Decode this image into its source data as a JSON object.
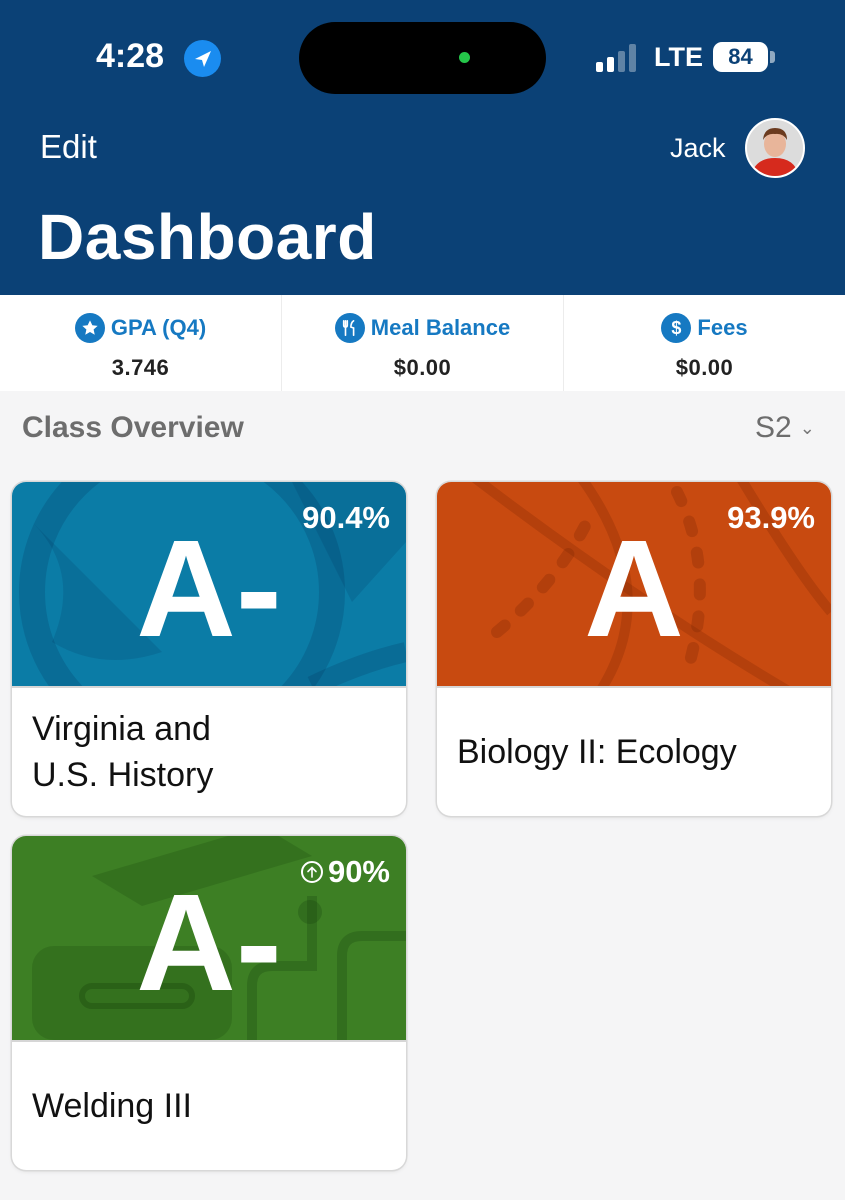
{
  "status_bar": {
    "time": "4:28",
    "network": "LTE",
    "battery": "84"
  },
  "header": {
    "edit_label": "Edit",
    "user_name": "Jack",
    "title": "Dashboard"
  },
  "stats": [
    {
      "label": "GPA (Q4)",
      "value": "3.746",
      "icon": "star-icon"
    },
    {
      "label": "Meal Balance",
      "value": "$0.00",
      "icon": "utensils-icon"
    },
    {
      "label": "Fees",
      "value": "$0.00",
      "icon": "dollar-icon"
    }
  ],
  "class_overview": {
    "title": "Class Overview",
    "term": "S2",
    "classes": [
      {
        "name_line1": "Virginia and",
        "name_line2": "U.S. History",
        "grade": "A-",
        "percent": "90.4%",
        "color": "#0b7ca6",
        "icon": "globe-icon"
      },
      {
        "name": "Biology II: Ecology",
        "grade": "A",
        "percent": "93.9%",
        "color": "#c84a10",
        "icon": "dna-icon"
      },
      {
        "name": "Welding III",
        "grade": "A-",
        "percent": "90%",
        "color": "#3d7f24",
        "icon": "graduation-cap-icon",
        "trend": "up"
      }
    ]
  },
  "colors": {
    "header_bg": "#0b4176",
    "accent": "#1679c2"
  }
}
